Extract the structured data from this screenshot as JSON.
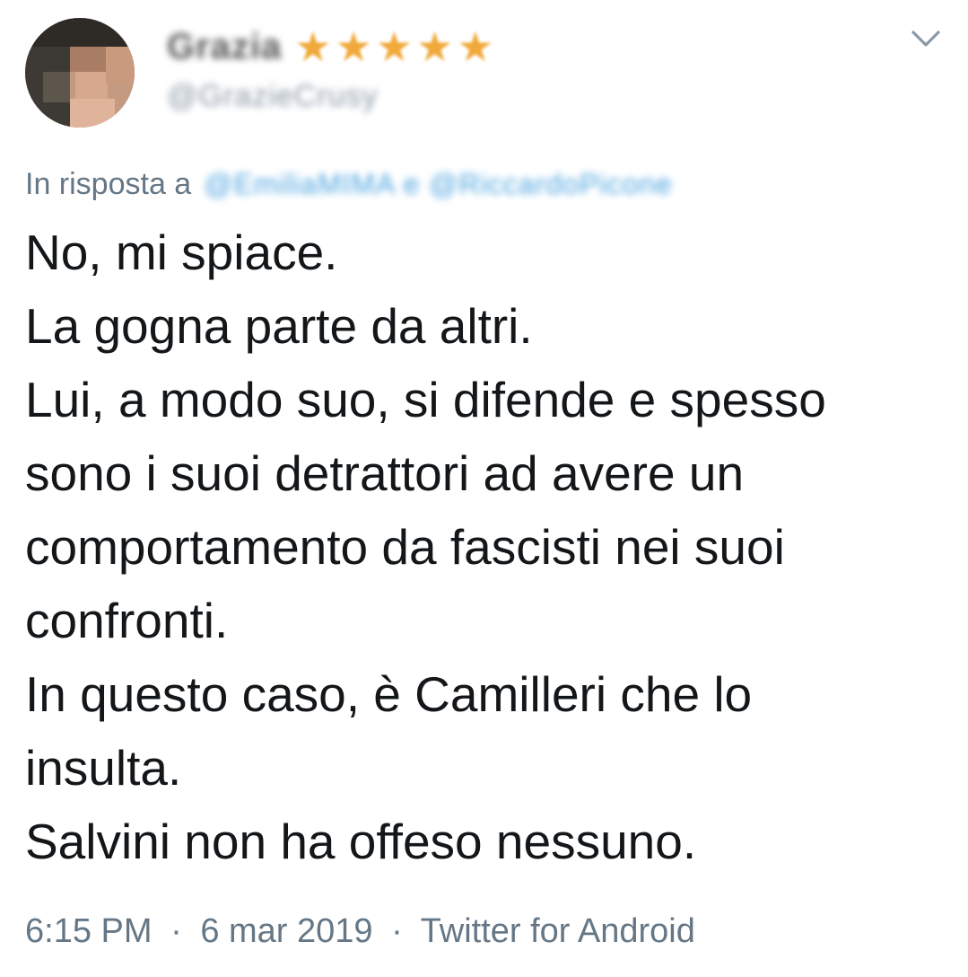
{
  "author": {
    "display_name": "Grazia",
    "handle": "@GrazieCrusy",
    "rating_stars": 5,
    "star_char": "★",
    "avatar_icon": "profile-photo-pixelated"
  },
  "menu": {
    "icon": "chevron-down-icon"
  },
  "reply": {
    "label": "In risposta a",
    "targets": "@EmiliaMIMA e @RiccardoPicone"
  },
  "tweet": {
    "lines": [
      "No, mi spiace.",
      "La gogna parte da altri.",
      "Lui, a modo suo, si difende e spesso",
      "sono i suoi detrattori ad avere un",
      "comportamento da fascisti nei suoi",
      "confronti.",
      "In questo caso, è Camilleri che lo",
      "insulta.",
      "Salvini non ha offeso nessuno."
    ]
  },
  "meta": {
    "time": "6:15 PM",
    "date": "6 mar 2019",
    "client": "Twitter for Android",
    "separator": "·"
  },
  "colors": {
    "text": "#14171a",
    "secondary": "#657786",
    "link": "#4aa3df",
    "star": "#f0a93a"
  }
}
